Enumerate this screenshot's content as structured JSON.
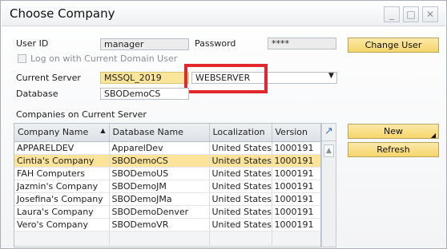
{
  "window": {
    "title": "Choose Company"
  },
  "login": {
    "user_id_label": "User ID",
    "user_id_value": "manager",
    "password_label": "Password",
    "password_value": "****",
    "domain_logon_label": "Log on with Current Domain User",
    "change_user_label": "Change User"
  },
  "server": {
    "current_server_label": "Current Server",
    "current_server_value": "MSSQL_2019",
    "server_name": "WEBSERVER",
    "database_label": "Database",
    "database_value": "SBODemoCS"
  },
  "companies": {
    "section_label": "Companies on Current Server",
    "columns": [
      "Company Name",
      "Database Name",
      "Localization",
      "Version"
    ],
    "sort_indicator": "▲",
    "rows": [
      {
        "name": "APPARELDEV",
        "db": "ApparelDev",
        "loc": "United States (",
        "ver": "1000191"
      },
      {
        "name": "Cintia's Company",
        "db": "SBODemoCS",
        "loc": "United States (",
        "ver": "1000191"
      },
      {
        "name": "FAH Computers",
        "db": "SBODemoUS",
        "loc": "United States (",
        "ver": "1000191"
      },
      {
        "name": "Jazmin's Company",
        "db": "SBODemoJM",
        "loc": "United States (",
        "ver": "1000191"
      },
      {
        "name": "Josefina's Company",
        "db": "SBODemoJMa",
        "loc": "United States (",
        "ver": "1000191"
      },
      {
        "name": "Laura's Company",
        "db": "SBODemoDenver",
        "loc": "United States (",
        "ver": "1000191"
      },
      {
        "name": "Vero's Company",
        "db": "SBODemoVR",
        "loc": "United States (",
        "ver": "1000191"
      }
    ],
    "selected_index": 1
  },
  "actions": {
    "new_label": "New",
    "refresh_label": "Refresh"
  },
  "colors": {
    "accent_yellow": "#fbe39a",
    "highlight_red": "#e0282e"
  }
}
